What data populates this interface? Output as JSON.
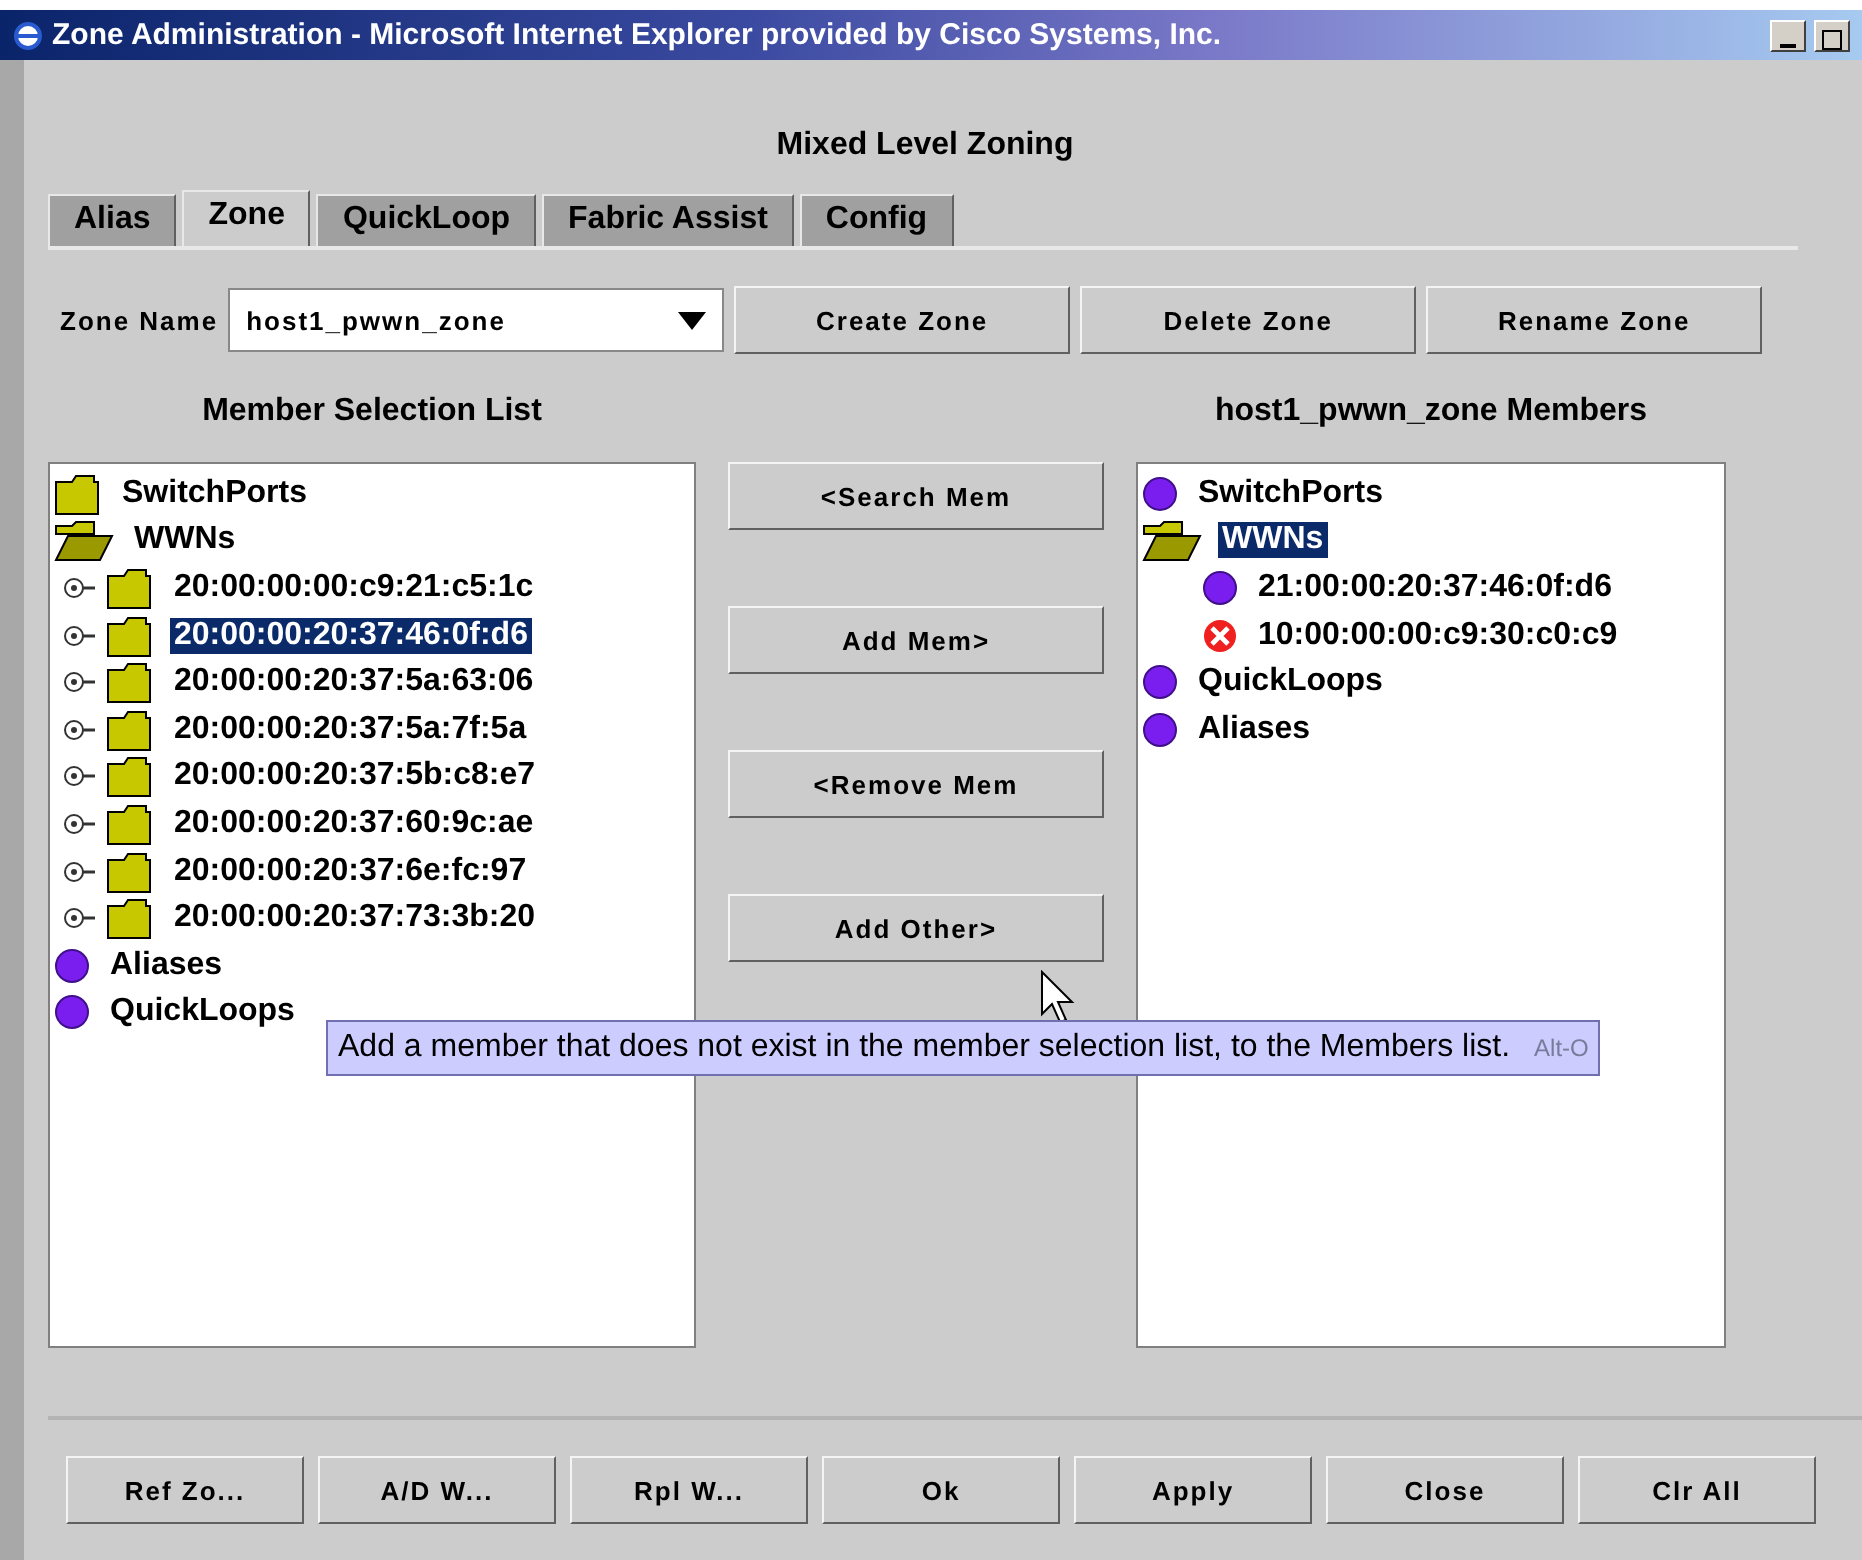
{
  "window": {
    "title": "Zone Administration - Microsoft Internet Explorer provided by Cisco Systems, Inc."
  },
  "heading": "Mixed Level Zoning",
  "tabs": [
    {
      "label": "Alias",
      "selected": false
    },
    {
      "label": "Zone",
      "selected": true
    },
    {
      "label": "QuickLoop",
      "selected": false
    },
    {
      "label": "Fabric Assist",
      "selected": false
    },
    {
      "label": "Config",
      "selected": false
    }
  ],
  "zone_name": {
    "label": "Zone Name",
    "value": "host1_pwwn_zone"
  },
  "zone_buttons": [
    "Create Zone",
    "Delete Zone",
    "Rename Zone"
  ],
  "member_selection": {
    "title": "Member Selection List",
    "items": [
      {
        "label": "SwitchPorts",
        "kind": "folder",
        "selected": false
      },
      {
        "label": "WWNs",
        "kind": "folder-open",
        "selected": false,
        "children": [
          {
            "label": "20:00:00:00:c9:21:c5:1c",
            "kind": "folder",
            "expandable": true,
            "selected": false
          },
          {
            "label": "20:00:00:20:37:46:0f:d6",
            "kind": "folder",
            "expandable": true,
            "selected": true
          },
          {
            "label": "20:00:00:20:37:5a:63:06",
            "kind": "folder",
            "expandable": true,
            "selected": false
          },
          {
            "label": "20:00:00:20:37:5a:7f:5a",
            "kind": "folder",
            "expandable": true,
            "selected": false
          },
          {
            "label": "20:00:00:20:37:5b:c8:e7",
            "kind": "folder",
            "expandable": true,
            "selected": false
          },
          {
            "label": "20:00:00:20:37:60:9c:ae",
            "kind": "folder",
            "expandable": true,
            "selected": false
          },
          {
            "label": "20:00:00:20:37:6e:fc:97",
            "kind": "folder",
            "expandable": true,
            "selected": false
          },
          {
            "label": "20:00:00:20:37:73:3b:20",
            "kind": "folder",
            "expandable": true,
            "selected": false
          }
        ]
      },
      {
        "label": "Aliases",
        "kind": "member",
        "selected": false
      },
      {
        "label": "QuickLoops",
        "kind": "member",
        "selected": false
      }
    ]
  },
  "action_buttons": [
    "<Search Mem",
    "Add Mem>",
    "<Remove Mem",
    "Add Other>"
  ],
  "zone_members": {
    "title": "host1_pwwn_zone Members",
    "items": [
      {
        "label": "SwitchPorts",
        "kind": "member",
        "selected": false
      },
      {
        "label": "WWNs",
        "kind": "folder-open",
        "selected": true,
        "children": [
          {
            "label": "21:00:00:20:37:46:0f:d6",
            "kind": "member",
            "selected": false
          },
          {
            "label": "10:00:00:00:c9:30:c0:c9",
            "kind": "error",
            "selected": false
          }
        ]
      },
      {
        "label": "QuickLoops",
        "kind": "member",
        "selected": false
      },
      {
        "label": "Aliases",
        "kind": "member",
        "selected": false
      }
    ]
  },
  "tooltip": {
    "text": "Add a member that does not exist in the member selection list, to the Members list.",
    "shortcut": "Alt-O"
  },
  "bottom_buttons": [
    "Ref Zo...",
    "A/D W...",
    "Rpl W...",
    "Ok",
    "Apply",
    "Close",
    "Clr All"
  ]
}
